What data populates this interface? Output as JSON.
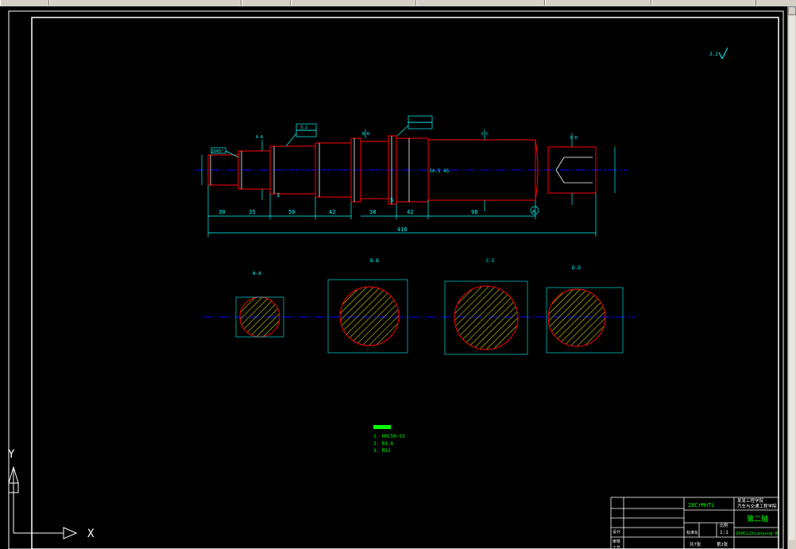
{
  "toolbar": {
    "partial_label": "",
    "segments": [
      "",
      "",
      "",
      "",
      ""
    ]
  },
  "ucs": {
    "x_label": "X",
    "y_label": "Y"
  },
  "drawing": {
    "section_labels": [
      "A-A",
      "B-B",
      "C-C",
      "D-D"
    ],
    "overall_length": "416",
    "segment_dims": [
      "30",
      "35",
      "50",
      "42",
      "38",
      "42",
      "98"
    ],
    "small_dims": [
      "3",
      "5",
      "8"
    ],
    "chamfer_label": "2X45°",
    "center_dim": "34.5 45",
    "datum": "A",
    "roughness_symbol": "3.2"
  },
  "notes": {
    "lines": [
      "1. HRC50~53",
      "2. R1.6",
      "3. M12"
    ]
  },
  "title_block": {
    "material": "20CrMnTi",
    "org_line1": "某某工程学院",
    "org_line2": "汽车与交通工程学院",
    "drawing_title": "第二轴",
    "drawing_number": "160CL2Xiaoyong-8",
    "scale": "1:1",
    "sheet_count": "共7张",
    "sheet_index": "第2张",
    "labels": [
      "设计",
      "审核",
      "工艺",
      "标准化",
      "比例",
      "重量",
      "数量"
    ]
  },
  "colors": {
    "cyan": "#00ffff",
    "red": "#ff0000",
    "green": "#00ff00",
    "white": "#ffffff",
    "blue": "#0000ff",
    "yellow": "#ffff00"
  }
}
